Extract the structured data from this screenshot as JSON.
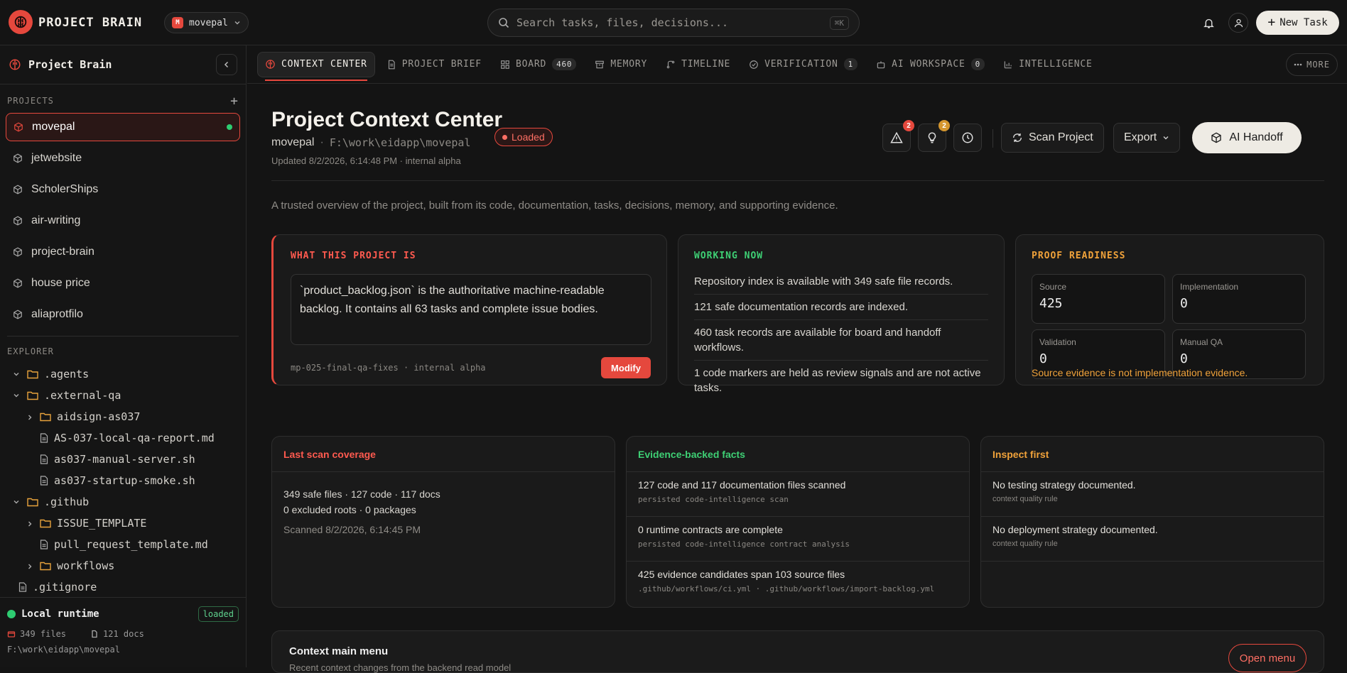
{
  "app": {
    "brand": "PROJECT BRAIN"
  },
  "topbar": {
    "project_initial": "M",
    "project_name": "movepal",
    "search_placeholder": "Search tasks, files, decisions...",
    "search_shortcut": "⌘K",
    "new_task_label": "New Task"
  },
  "sidebar": {
    "title": "Project Brain",
    "projects_label": "PROJECTS",
    "projects": [
      {
        "name": "movepal",
        "active": true
      },
      {
        "name": "jetwebsite"
      },
      {
        "name": "ScholerShips"
      },
      {
        "name": "air-writing"
      },
      {
        "name": "project-brain"
      },
      {
        "name": "house price"
      },
      {
        "name": "aliaprotfilo"
      }
    ],
    "explorer_label": "EXPLORER",
    "tree": [
      {
        "name": ".agents",
        "type": "folder",
        "depth": 0,
        "expanded": true
      },
      {
        "name": ".external-qa",
        "type": "folder",
        "depth": 0,
        "expanded": true
      },
      {
        "name": "aidsign-as037",
        "type": "folder",
        "depth": 1,
        "expanded": false
      },
      {
        "name": "AS-037-local-qa-report.md",
        "type": "file",
        "depth": 1
      },
      {
        "name": "as037-manual-server.sh",
        "type": "file",
        "depth": 1
      },
      {
        "name": "as037-startup-smoke.sh",
        "type": "file",
        "depth": 1
      },
      {
        "name": ".github",
        "type": "folder",
        "depth": 0,
        "expanded": true
      },
      {
        "name": "ISSUE_TEMPLATE",
        "type": "folder",
        "depth": 1,
        "expanded": false
      },
      {
        "name": "pull_request_template.md",
        "type": "file",
        "depth": 1
      },
      {
        "name": "workflows",
        "type": "folder",
        "depth": 1,
        "expanded": false
      },
      {
        "name": ".gitignore",
        "type": "file",
        "depth": 0
      }
    ],
    "runtime": {
      "label": "Local runtime",
      "status": "loaded",
      "files": "349 files",
      "docs": "121 docs",
      "path": "F:\\work\\eidapp\\movepal"
    }
  },
  "tabs": [
    {
      "label": "CONTEXT CENTER",
      "icon": "brain-icon",
      "active": true
    },
    {
      "label": "PROJECT BRIEF",
      "icon": "document-icon"
    },
    {
      "label": "BOARD",
      "icon": "grid-icon",
      "count": "460"
    },
    {
      "label": "MEMORY",
      "icon": "archive-icon"
    },
    {
      "label": "TIMELINE",
      "icon": "branch-icon"
    },
    {
      "label": "VERIFICATION",
      "icon": "check-circle-icon",
      "count": "1"
    },
    {
      "label": "AI WORKSPACE",
      "icon": "bot-icon",
      "count": "0"
    },
    {
      "label": "INTELLIGENCE",
      "icon": "bar-chart-icon"
    }
  ],
  "tabs_more": "MORE",
  "header": {
    "title": "Project Context Center",
    "status": "Loaded",
    "project": "movepal",
    "separator": "·",
    "path": "F:\\work\\eidapp\\movepal",
    "updated": "Updated 8/2/2026, 6:14:48 PM · internal alpha",
    "alerts_count": "2",
    "ideas_count": "2",
    "scan_label": "Scan Project",
    "export_label": "Export",
    "handoff_label": "AI Handoff",
    "description": "A trusted overview of the project, built from its code, documentation, tasks, decisions, memory, and supporting evidence."
  },
  "what_is": {
    "heading": "WHAT THIS PROJECT IS",
    "text": "`product_backlog.json` is the authoritative machine-readable backlog. It contains all 63 tasks and complete issue bodies.",
    "meta": "mp-025-final-qa-fixes · internal alpha",
    "modify_label": "Modify"
  },
  "working_now": {
    "heading": "WORKING NOW",
    "items": [
      "Repository index is available with 349 safe file records.",
      "121 safe documentation records are indexed.",
      "460 task records are available for board and handoff workflows.",
      "1 code markers are held as review signals and are not active tasks."
    ]
  },
  "proof": {
    "heading": "PROOF READINESS",
    "boxes": [
      {
        "label": "Source",
        "value": "425"
      },
      {
        "label": "Implementation",
        "value": "0"
      },
      {
        "label": "Validation",
        "value": "0"
      },
      {
        "label": "Manual QA",
        "value": "0"
      }
    ],
    "note": "Source evidence is not implementation evidence."
  },
  "last_scan": {
    "heading": "Last scan coverage",
    "line1": "349 safe files · 127 code · 117 docs",
    "line2": "0 excluded roots · 0 packages",
    "scanned": "Scanned 8/2/2026, 6:14:45 PM"
  },
  "facts": {
    "heading": "Evidence-backed facts",
    "items": [
      {
        "title": "127 code and 117 documentation files scanned",
        "sub": "persisted code-intelligence scan"
      },
      {
        "title": "0 runtime contracts are complete",
        "sub": "persisted code-intelligence contract analysis"
      },
      {
        "title": "425 evidence candidates span 103 source files",
        "sub": ".github/workflows/ci.yml · .github/workflows/import-backlog.yml"
      }
    ]
  },
  "inspect": {
    "heading": "Inspect first",
    "items": [
      {
        "title": "No testing strategy documented.",
        "sub": "context quality rule"
      },
      {
        "title": "No deployment strategy documented.",
        "sub": "context quality rule"
      }
    ]
  },
  "context_menu": {
    "title": "Context main menu",
    "subtitle": "Recent context changes from the backend read model",
    "open_label": "Open menu"
  },
  "colors": {
    "accent": "#e5483d",
    "green": "#3ecf74",
    "orange": "#f0a23a"
  }
}
